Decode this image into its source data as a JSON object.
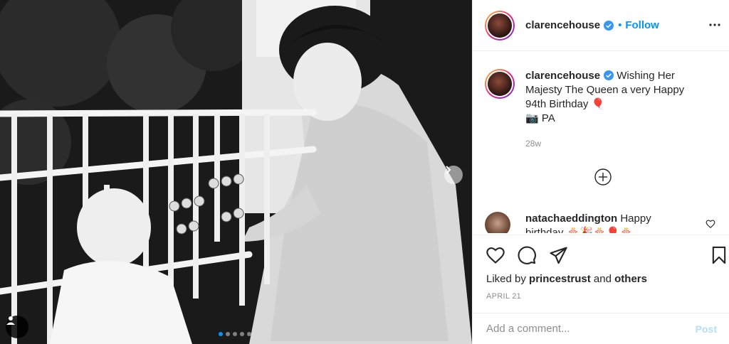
{
  "post": {
    "image": {
      "description_icon": "user-tag-icon",
      "carousel": {
        "count": 5,
        "active_index": 0
      }
    }
  },
  "header": {
    "username": "clarencehouse",
    "separator": "•",
    "follow_label": "Follow"
  },
  "caption": {
    "username": "clarencehouse",
    "text": "Wishing Her Majesty The Queen a very Happy 94th Birthday 🎈",
    "credit": "📷 PA",
    "age": "28w"
  },
  "comments": [
    {
      "username": "natachaeddington",
      "text": "Happy birthday 🎂🎉🎂🎈🎂"
    }
  ],
  "likes": {
    "prefix": "Liked by",
    "user": "princestrust",
    "joiner": "and",
    "others": "others"
  },
  "date": "APRIL 21",
  "add_comment": {
    "placeholder": "Add a comment...",
    "post_label": "Post"
  },
  "colors": {
    "accent": "#0095f6",
    "post_disabled": "#b2dffc",
    "muted": "#8e8e8e",
    "text": "#262626"
  }
}
